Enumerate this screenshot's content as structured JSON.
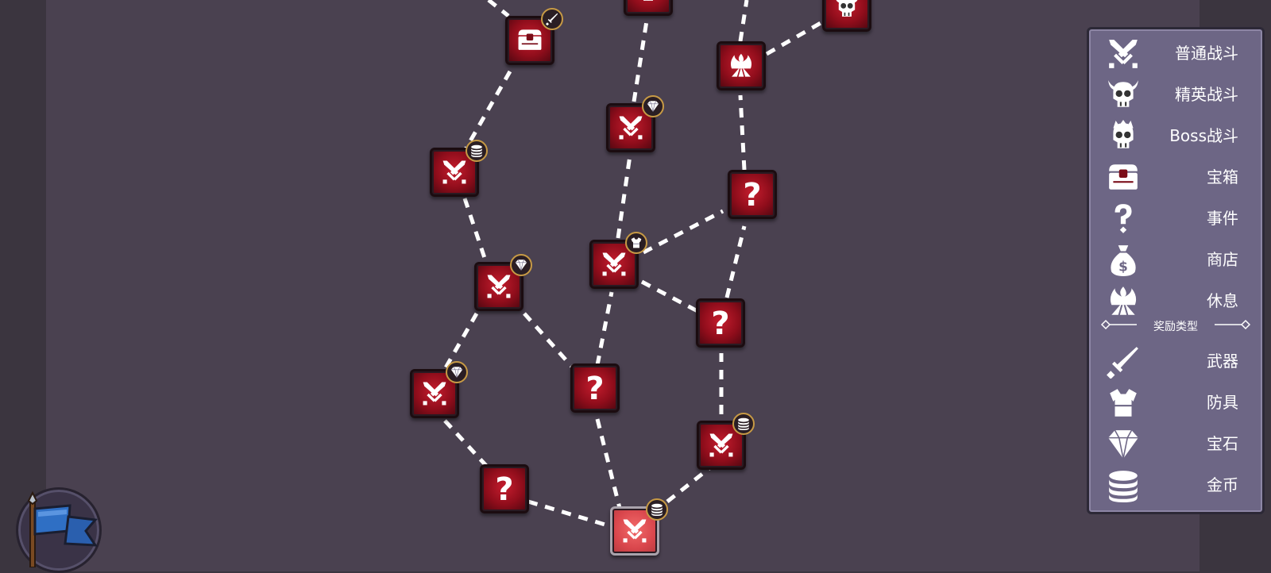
{
  "map": {
    "nodes": [
      {
        "id": "n1",
        "type": "chest",
        "reward": "weapon"
      },
      {
        "id": "n2",
        "type": "elite",
        "reward": ""
      },
      {
        "id": "n3",
        "type": "elite",
        "reward": ""
      },
      {
        "id": "n4",
        "type": "rest",
        "reward": ""
      },
      {
        "id": "n5",
        "type": "battle",
        "reward": "gem"
      },
      {
        "id": "n6",
        "type": "battle",
        "reward": "coin"
      },
      {
        "id": "n7",
        "type": "event",
        "reward": ""
      },
      {
        "id": "n8",
        "type": "battle",
        "reward": "armor"
      },
      {
        "id": "n9",
        "type": "battle",
        "reward": "gem"
      },
      {
        "id": "n10",
        "type": "event",
        "reward": ""
      },
      {
        "id": "n11",
        "type": "battle",
        "reward": "gem"
      },
      {
        "id": "n12",
        "type": "event",
        "reward": ""
      },
      {
        "id": "n13",
        "type": "battle",
        "reward": "coin"
      },
      {
        "id": "n14",
        "type": "event",
        "reward": ""
      },
      {
        "id": "n15",
        "type": "battle",
        "reward": "coin",
        "current": true
      }
    ],
    "event_symbol": "?"
  },
  "legend": {
    "items": [
      {
        "icon": "swords-icon",
        "label": "普通战斗"
      },
      {
        "icon": "horned-skull-icon",
        "label": "精英战斗"
      },
      {
        "icon": "crowned-skull-icon",
        "label": "Boss战斗"
      },
      {
        "icon": "chest-icon",
        "label": "宝箱"
      },
      {
        "icon": "question-icon",
        "label": "事件"
      },
      {
        "icon": "money-bag-icon",
        "label": "商店"
      },
      {
        "icon": "campfire-icon",
        "label": "休息"
      }
    ],
    "reward_title": "奖励类型",
    "rewards": [
      {
        "icon": "sword-icon",
        "label": "武器"
      },
      {
        "icon": "armor-icon",
        "label": "防具"
      },
      {
        "icon": "gem-icon",
        "label": "宝石"
      },
      {
        "icon": "coins-icon",
        "label": "金币"
      }
    ]
  },
  "colors": {
    "node_red": "#8f0d1b",
    "badge_ring": "#c79a45",
    "legend_bg": "#6d6685",
    "map_bg": "#4a4150"
  }
}
